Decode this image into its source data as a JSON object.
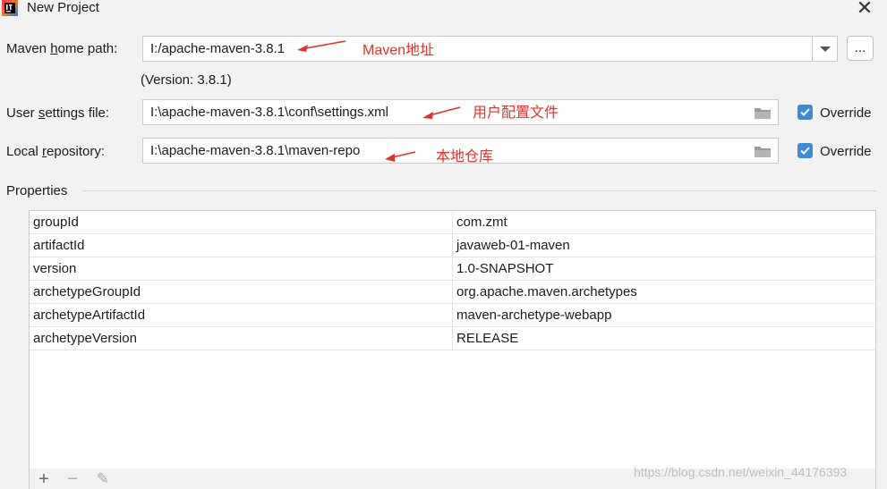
{
  "window": {
    "title": "New Project",
    "close_glyph": "✕"
  },
  "maven_home": {
    "label_pre": "Maven ",
    "label_mnemonic": "h",
    "label_post": "ome path:",
    "value": "I:/apache-maven-3.8.1",
    "version_text": "(Version: 3.8.1)",
    "browse_label": "...",
    "annotation": "Maven地址"
  },
  "user_settings": {
    "label_pre": "User ",
    "label_mnemonic": "s",
    "label_post": "ettings file:",
    "value": "I:\\apache-maven-3.8.1\\conf\\settings.xml",
    "override_label": "Override",
    "override_checked": true,
    "annotation": "用户配置文件"
  },
  "local_repo": {
    "label_pre": "Local ",
    "label_mnemonic": "r",
    "label_post": "epository:",
    "value": "I:\\apache-maven-3.8.1\\maven-repo",
    "override_label": "Override",
    "override_checked": true,
    "annotation": "本地仓库"
  },
  "properties": {
    "section_label": "Properties",
    "rows": [
      {
        "key": "groupId",
        "value": "com.zmt"
      },
      {
        "key": "artifactId",
        "value": "javaweb-01-maven"
      },
      {
        "key": "version",
        "value": "1.0-SNAPSHOT"
      },
      {
        "key": "archetypeGroupId",
        "value": "org.apache.maven.archetypes"
      },
      {
        "key": "archetypeArtifactId",
        "value": "maven-archetype-webapp"
      },
      {
        "key": "archetypeVersion",
        "value": "RELEASE"
      }
    ],
    "toolbar": {
      "add_glyph": "+",
      "remove_glyph": "−",
      "edit_glyph": "✎"
    }
  },
  "watermark": "https://blog.csdn.net/weixin_44176393",
  "colors": {
    "accent": "#3c8ad8",
    "annotation": "#e0312c",
    "background": "#f2f2f2"
  }
}
